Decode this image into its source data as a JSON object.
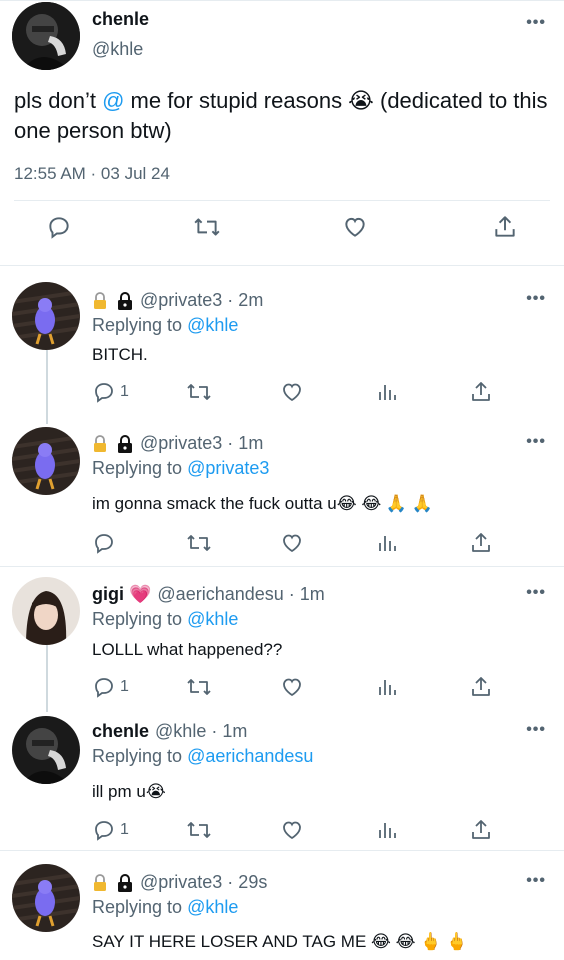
{
  "main_tweet": {
    "name": "chenle",
    "handle": "@khle",
    "text_pre": "pls don’t ",
    "text_mention": "@",
    "text_post": " me for stupid reasons 😭 (dedicated to this one person btw)",
    "time": "12:55 AM · 03 Jul 24",
    "more": "•••"
  },
  "replies": [
    {
      "lock_prefix": "🔒 🔒",
      "handle_time": "@private3 · 2m",
      "replying_label": "Replying to ",
      "replying_to": "@khle",
      "text": "BITCH.",
      "reply_count": "1",
      "more": "•••"
    },
    {
      "lock_prefix": "🔒 🔒",
      "handle_time": "@private3 · 1m",
      "replying_label": "Replying to ",
      "replying_to": "@private3",
      "text": "im gonna smack the fuck outta u😂 😂 🙏 🙏",
      "reply_count": "",
      "more": "•••"
    },
    {
      "name": "gigi 💗",
      "handle_time": "@aerichandesu · 1m",
      "replying_label": "Replying to ",
      "replying_to": "@khle",
      "text": "LOLLL what happened??",
      "reply_count": "1",
      "more": "•••"
    },
    {
      "name": "chenle",
      "handle_time": "@khle · 1m",
      "replying_label": "Replying to ",
      "replying_to": "@aerichandesu",
      "text": "ill pm u😭",
      "reply_count": "1",
      "more": "•••"
    },
    {
      "lock_prefix": "🔒 🔒",
      "handle_time": "@private3 · 29s",
      "replying_label": "Replying to ",
      "replying_to": "@khle",
      "text": "SAY IT HERE LOSER AND TAG ME 😂 😂 🖕 🖕",
      "reply_count": "",
      "more": "•••"
    }
  ],
  "colors": {
    "accent": "#1d9bf0",
    "muted": "#536471",
    "divider": "#e6ecf0"
  },
  "icons": [
    "reply-icon",
    "retweet-icon",
    "like-icon",
    "share-icon",
    "analytics-icon",
    "lock-icon",
    "more-icon"
  ]
}
